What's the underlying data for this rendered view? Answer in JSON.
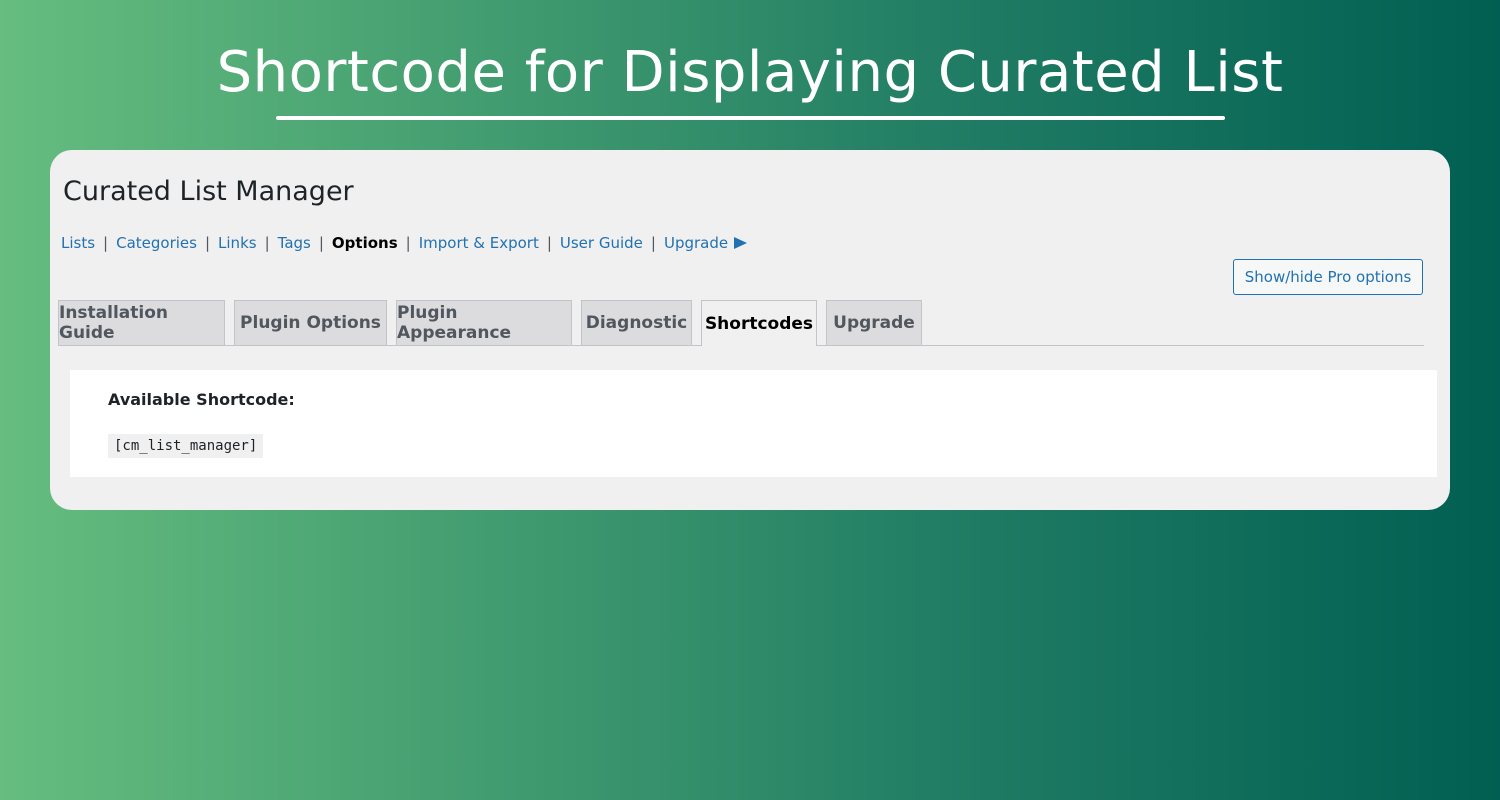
{
  "banner": {
    "title": "Shortcode for Displaying Curated List"
  },
  "app": {
    "title": "Curated List Manager"
  },
  "subnav": {
    "items": [
      {
        "label": "Lists"
      },
      {
        "label": "Categories"
      },
      {
        "label": "Links"
      },
      {
        "label": "Tags"
      },
      {
        "label": "Options",
        "current": true
      },
      {
        "label": "Import & Export"
      },
      {
        "label": "User Guide"
      },
      {
        "label": "Upgrade"
      }
    ],
    "separator": "|"
  },
  "pro_button": {
    "label": "Show/hide Pro options"
  },
  "tabs": [
    {
      "label": "Installation Guide"
    },
    {
      "label": "Plugin Options"
    },
    {
      "label": "Plugin Appearance"
    },
    {
      "label": "Diagnostic"
    },
    {
      "label": "Shortcodes",
      "active": true
    },
    {
      "label": "Upgrade"
    }
  ],
  "content": {
    "heading": "Available Shortcode:",
    "shortcode": "[cm_list_manager]"
  },
  "colors": {
    "link": "#2271b1",
    "panel_bg": "#f0f0f1",
    "tab_bg": "#dcdcde",
    "gradient_start": "#66bd7f",
    "gradient_end": "#005f52"
  }
}
